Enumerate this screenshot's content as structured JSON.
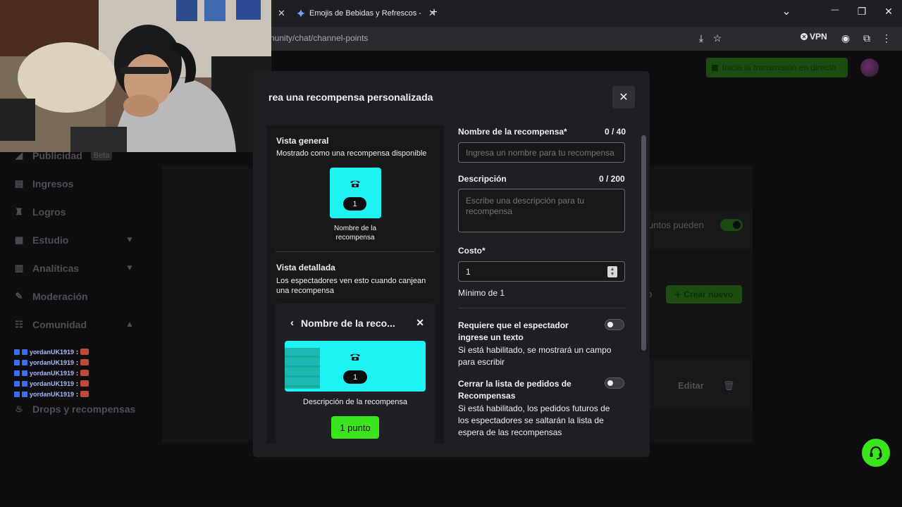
{
  "browser": {
    "tab_active_title": "Emojis de Bebidas y Refrescos -",
    "url": "nunity/chat/channel-points",
    "vpn_label": "VPN",
    "close_glyph": "✕",
    "newtab_glyph": "+",
    "chevron_glyph": "⌄",
    "min_glyph": "—",
    "restore_glyph": "❐",
    "win_close_glyph": "✕"
  },
  "background": {
    "live_button": "Inicia la transmisión en directo",
    "sidebar": [
      {
        "label": "Publicidad",
        "badge": "Beta",
        "icon": "megaphone-icon"
      },
      {
        "label": "Ingresos",
        "icon": "chart-icon"
      },
      {
        "label": "Logros",
        "icon": "trophy-icon"
      },
      {
        "label": "Estudio",
        "icon": "film-icon"
      },
      {
        "label": "Analíticas",
        "icon": "analytics-icon"
      },
      {
        "label": "Moderación",
        "icon": "wrench-icon"
      },
      {
        "label": "Comunidad",
        "icon": "community-icon"
      },
      {
        "label": "Drops y recompensas",
        "icon": "gift-icon"
      }
    ],
    "text_puntos": "untos pueden",
    "text_o": "o",
    "crear_nuevo": "Crear nuevo",
    "editar": "Editar"
  },
  "chat_overlay": {
    "username": "yordanUK1919",
    "separator": ":",
    "line_count": 5
  },
  "modal": {
    "title": "rea una recompensa personalizada",
    "close_glyph": "✕",
    "preview": {
      "general_title": "Vista general",
      "general_subtitle": "Mostrado como una recompensa disponible",
      "tile_cost": "1",
      "tile_name": "Nombre de la recompensa",
      "detail_title": "Vista detallada",
      "detail_subtitle": "Los espectadores ven esto cuando canjean una recompensa",
      "detail_header": "Nombre de la reco...",
      "detail_cost": "1",
      "detail_description": "Descripción de la recompensa",
      "redeem_label": "1 punto"
    },
    "form": {
      "name_label": "Nombre de la recompensa*",
      "name_count": "0 / 40",
      "name_placeholder": "Ingresa un nombre para tu recompensa",
      "desc_label": "Descripción",
      "desc_count": "0 / 200",
      "desc_placeholder": "Escribe una descripción para tu recompensa",
      "cost_label": "Costo*",
      "cost_value": "1",
      "cost_min": "Mínimo de 1",
      "require_text_label": "Requiere que el espectador ingrese un texto",
      "require_text_help": "Si está habilitado, se mostrará un campo para escribir",
      "require_text_enabled": false,
      "skip_queue_label": "Cerrar la lista de pedidos de Recompensas",
      "skip_queue_help": "Si está habilitado, los pedidos futuros de los espectadores se saltarán la lista de espera de las recompensas",
      "skip_queue_enabled": false
    }
  },
  "colors": {
    "accent_green": "#3be51d",
    "tile_cyan": "#1ff2f2",
    "modal_bg": "#1f1f23"
  }
}
